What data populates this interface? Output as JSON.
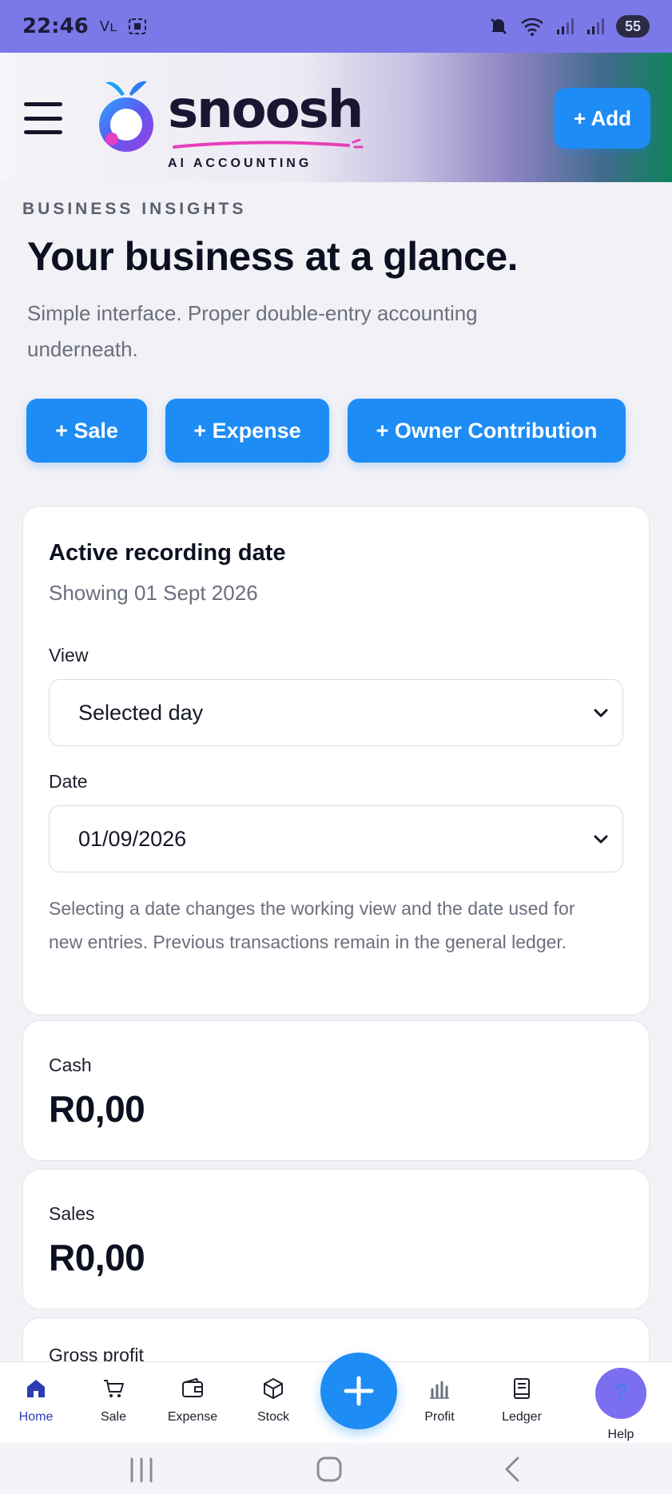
{
  "status_bar": {
    "time": "22:46",
    "left_indicators": "Vʟ",
    "battery": "55"
  },
  "header": {
    "logo_word": "snoosh",
    "logo_tagline": "AI ACCOUNTING",
    "add_label": "+ Add"
  },
  "main": {
    "eyebrow": "BUSINESS INSIGHTS",
    "headline": "Your business at a glance.",
    "subtitle": "Simple interface. Proper double-entry accounting underneath.",
    "actions": [
      {
        "label": "+ Sale"
      },
      {
        "label": "+ Expense"
      },
      {
        "label": "+ Owner Contribution"
      }
    ]
  },
  "date_card": {
    "title": "Active recording date",
    "subtitle": "Showing 01 Sept 2026",
    "view_label": "View",
    "view_value": "Selected day",
    "date_label": "Date",
    "date_value": "01/09/2026",
    "help": "Selecting a date changes the working view and the date used for new entries. Previous transactions remain in the general ledger."
  },
  "stats": [
    {
      "label": "Cash",
      "value": "R0,00"
    },
    {
      "label": "Sales",
      "value": "R0,00"
    },
    {
      "label": "Gross profit"
    }
  ],
  "bottom_nav": {
    "items": [
      {
        "label": "Home",
        "icon": "home-icon"
      },
      {
        "label": "Sale",
        "icon": "cart-icon"
      },
      {
        "label": "Expense",
        "icon": "wallet-icon"
      },
      {
        "label": "Stock",
        "icon": "box-icon"
      },
      {
        "label": "Profit",
        "icon": "bar-chart-icon"
      },
      {
        "label": "Ledger",
        "icon": "book-icon"
      }
    ],
    "help_label": "Help",
    "help_glyph": "?"
  },
  "colors": {
    "accent": "#1e8cf5",
    "status_bar": "#7b78e8",
    "help_bubble": "#7b6ef0",
    "active_nav": "#2b3cb0"
  }
}
